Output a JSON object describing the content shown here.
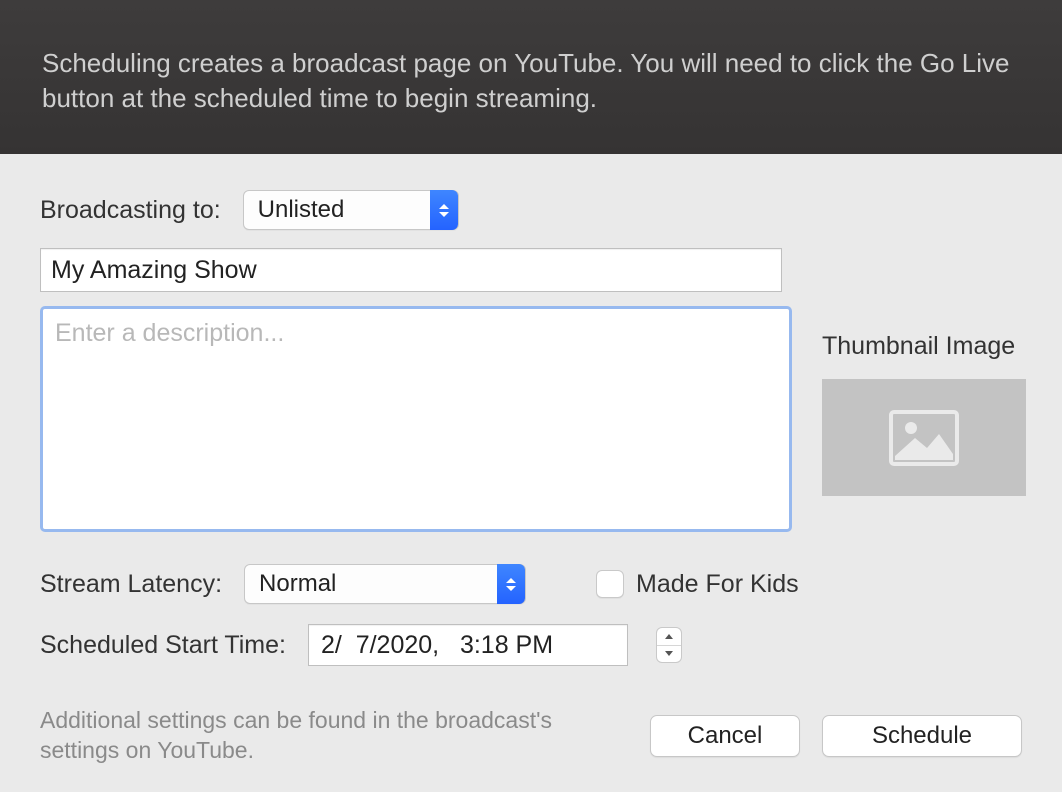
{
  "header": {
    "message": "Scheduling creates a broadcast page on YouTube. You will need to click the Go Live button at the scheduled time to begin streaming."
  },
  "form": {
    "broadcasting_label": "Broadcasting to:",
    "broadcasting_value": "Unlisted",
    "title_value": "My Amazing Show",
    "description_value": "",
    "description_placeholder": "Enter a description...",
    "thumbnail_label": "Thumbnail Image",
    "latency_label": "Stream Latency:",
    "latency_value": "Normal",
    "made_for_kids_label": "Made For Kids",
    "made_for_kids_checked": false,
    "scheduled_label": "Scheduled Start Time:",
    "scheduled_value": "2/  7/2020,   3:18 PM"
  },
  "footer": {
    "note": "Additional settings can be found in the broadcast's settings on YouTube.",
    "cancel": "Cancel",
    "schedule": "Schedule"
  }
}
